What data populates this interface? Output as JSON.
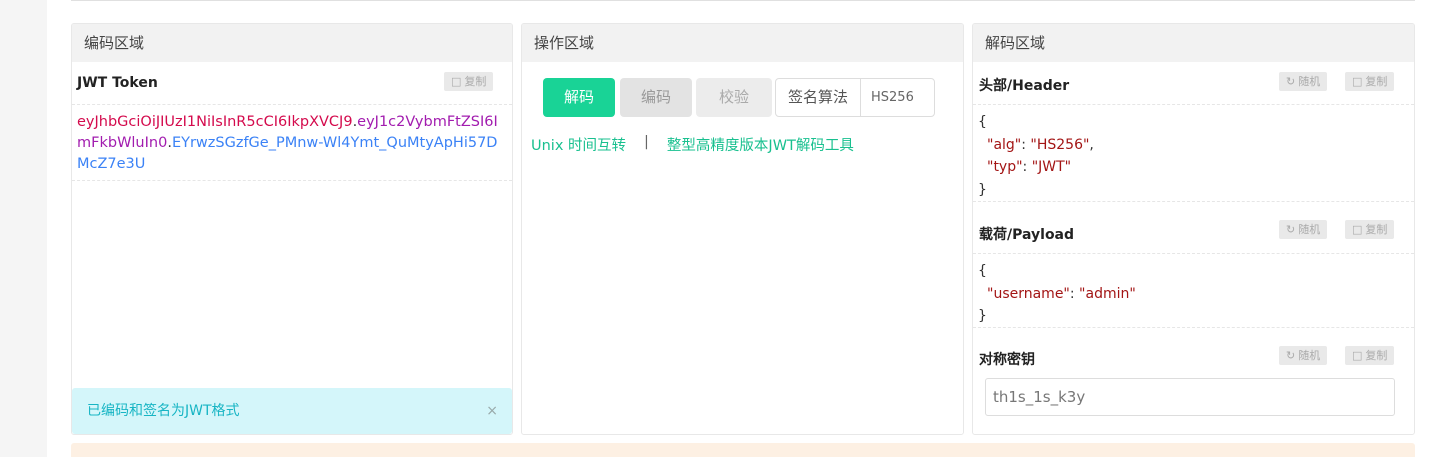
{
  "encode_panel": {
    "title": "编码区域",
    "token_label": "JWT Token",
    "copy_label": "复制",
    "token": {
      "header": "eyJhbGciOiJIUzI1NiIsInR5cCI6IkpXVCJ9",
      "payload": "eyJ1c2VybmFtZSI6ImFkbWluIn0",
      "signature": "EYrwzSGzfGe_PMnw-Wl4Ymt_QuMtyApHi57DMcZ7e3U",
      "dot": "."
    },
    "alert": "已编码和签名为JWT格式",
    "alert_close": "×"
  },
  "ops_panel": {
    "title": "操作区域",
    "decode_btn": "解码",
    "encode_btn": "编码",
    "verify_btn": "校验",
    "algo_label": "签名算法",
    "algo_value": "HS256",
    "link_unix": "Unix 时间互转",
    "link_sep": "|",
    "link_bigint": "整型高精度版本JWT解码工具"
  },
  "decode_panel": {
    "title": "解码区域",
    "random_label": "随机",
    "copy_label": "复制",
    "header_title": "头部/Header",
    "header_json": {
      "open": "{",
      "l1_key": "\"alg\"",
      "l1_val": "\"HS256\"",
      "l2_key": "\"typ\"",
      "l2_val": "\"JWT\"",
      "close": "}"
    },
    "payload_title": "载荷/Payload",
    "payload_json": {
      "open": "{",
      "l1_key": "\"username\"",
      "l1_val": "\"admin\"",
      "close": "}"
    },
    "secret_title": "对称密钥",
    "secret_value": "th1s_1s_k3y"
  },
  "colors": {
    "accent": "#19d396",
    "token_header": "#d40b4d",
    "token_payload": "#a21caf",
    "token_signature": "#3b82f6",
    "json_key": "#a31515",
    "alert_bg": "#d4f6fa",
    "alert_text": "#17b5c4"
  }
}
